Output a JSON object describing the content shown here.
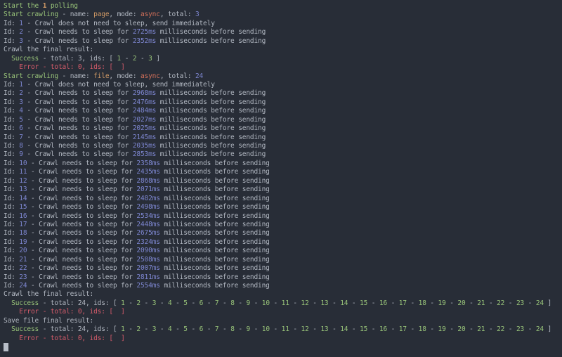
{
  "palette": {
    "background": "#282d37",
    "default": "#b2b8c2",
    "green": "#98c379",
    "orange": "#d19a66",
    "async": "#d2705a",
    "blue": "#7d86d0",
    "red": "#d65c6b",
    "cursor": "#b8bec8"
  },
  "phrases": {
    "id_label": "Id: ",
    "immediate_suffix": " - Crawl does not need to sleep, send immediately",
    "sleep_mid": " - Crawl needs to sleep for ",
    "sleep_suffix": " milliseconds before sending",
    "result_mid": " - total: ",
    "result_ids": ", ids: ",
    "bracket_open": "[ ",
    "bracket_close": " ]",
    "id_separator": " - "
  },
  "lines": [
    {
      "kind": "segments",
      "parts": [
        [
          "Start the ",
          "green"
        ],
        [
          "1",
          "orange",
          true
        ],
        [
          " polling",
          "green"
        ]
      ]
    },
    {
      "kind": "segments",
      "parts": [
        [
          "Start crawling",
          "green"
        ],
        [
          " - name: "
        ],
        [
          "page",
          "orange"
        ],
        [
          ", mode: "
        ],
        [
          "async",
          "async"
        ],
        [
          ", total: "
        ],
        [
          "3",
          "blue"
        ]
      ]
    },
    {
      "kind": "immediate",
      "id": 1
    },
    {
      "kind": "sleep",
      "id": 2,
      "ms": "2725ms"
    },
    {
      "kind": "sleep",
      "id": 3,
      "ms": "2352ms"
    },
    {
      "kind": "segments",
      "parts": [
        [
          "Crawl the final result:"
        ]
      ]
    },
    {
      "kind": "result",
      "indent": 2,
      "label": "Success",
      "label_color": "green",
      "total": 3,
      "ids": [
        1,
        2,
        3
      ],
      "id_color": "green",
      "text_color": "default"
    },
    {
      "kind": "result",
      "indent": 4,
      "label": "Error",
      "label_color": "red",
      "total": 0,
      "ids": [],
      "id_color": "red",
      "text_color": "red"
    },
    {
      "kind": "segments",
      "parts": [
        [
          "Start crawling",
          "green"
        ],
        [
          " - name: "
        ],
        [
          "file",
          "orange"
        ],
        [
          ", mode: "
        ],
        [
          "async",
          "async"
        ],
        [
          ", total: "
        ],
        [
          "24",
          "blue"
        ]
      ]
    },
    {
      "kind": "immediate",
      "id": 1
    },
    {
      "kind": "sleep",
      "id": 2,
      "ms": "2968ms"
    },
    {
      "kind": "sleep",
      "id": 3,
      "ms": "2476ms"
    },
    {
      "kind": "sleep",
      "id": 4,
      "ms": "2484ms"
    },
    {
      "kind": "sleep",
      "id": 5,
      "ms": "2027ms"
    },
    {
      "kind": "sleep",
      "id": 6,
      "ms": "2025ms"
    },
    {
      "kind": "sleep",
      "id": 7,
      "ms": "2145ms"
    },
    {
      "kind": "sleep",
      "id": 8,
      "ms": "2035ms"
    },
    {
      "kind": "sleep",
      "id": 9,
      "ms": "2853ms"
    },
    {
      "kind": "sleep",
      "id": 10,
      "ms": "2358ms"
    },
    {
      "kind": "sleep",
      "id": 11,
      "ms": "2435ms"
    },
    {
      "kind": "sleep",
      "id": 12,
      "ms": "2868ms"
    },
    {
      "kind": "sleep",
      "id": 13,
      "ms": "2071ms"
    },
    {
      "kind": "sleep",
      "id": 14,
      "ms": "2482ms"
    },
    {
      "kind": "sleep",
      "id": 15,
      "ms": "2498ms"
    },
    {
      "kind": "sleep",
      "id": 16,
      "ms": "2534ms"
    },
    {
      "kind": "sleep",
      "id": 17,
      "ms": "2448ms"
    },
    {
      "kind": "sleep",
      "id": 18,
      "ms": "2675ms"
    },
    {
      "kind": "sleep",
      "id": 19,
      "ms": "2324ms"
    },
    {
      "kind": "sleep",
      "id": 20,
      "ms": "2090ms"
    },
    {
      "kind": "sleep",
      "id": 21,
      "ms": "2508ms"
    },
    {
      "kind": "sleep",
      "id": 22,
      "ms": "2007ms"
    },
    {
      "kind": "sleep",
      "id": 23,
      "ms": "2811ms"
    },
    {
      "kind": "sleep",
      "id": 24,
      "ms": "2554ms"
    },
    {
      "kind": "segments",
      "parts": [
        [
          "Crawl the final result:"
        ]
      ]
    },
    {
      "kind": "result",
      "indent": 2,
      "label": "Success",
      "label_color": "green",
      "total": 24,
      "ids": [
        1,
        2,
        3,
        4,
        5,
        6,
        7,
        8,
        9,
        10,
        11,
        12,
        13,
        14,
        15,
        16,
        17,
        18,
        19,
        20,
        21,
        22,
        23,
        24
      ],
      "id_color": "green",
      "text_color": "default"
    },
    {
      "kind": "result",
      "indent": 4,
      "label": "Error",
      "label_color": "red",
      "total": 0,
      "ids": [],
      "id_color": "red",
      "text_color": "red"
    },
    {
      "kind": "segments",
      "parts": [
        [
          "Save file final result:"
        ]
      ]
    },
    {
      "kind": "result",
      "indent": 2,
      "label": "Success",
      "label_color": "green",
      "total": 24,
      "ids": [
        1,
        2,
        3,
        4,
        5,
        6,
        7,
        8,
        9,
        10,
        11,
        12,
        13,
        14,
        15,
        16,
        17,
        18,
        19,
        20,
        21,
        22,
        23,
        24
      ],
      "id_color": "green",
      "text_color": "default"
    },
    {
      "kind": "result",
      "indent": 4,
      "label": "Error",
      "label_color": "red",
      "total": 0,
      "ids": [],
      "id_color": "red",
      "text_color": "red"
    },
    {
      "kind": "cursor"
    }
  ]
}
